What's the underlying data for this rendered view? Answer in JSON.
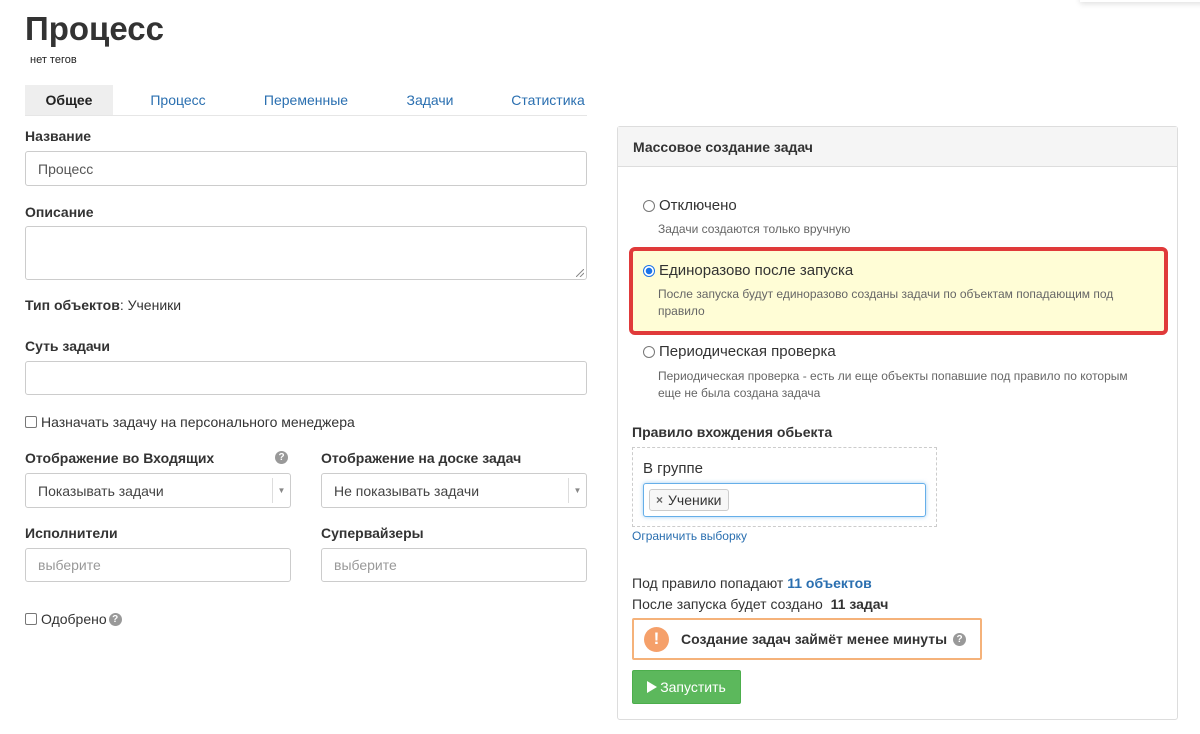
{
  "page": {
    "title": "Процесс",
    "tags": "нет тегов"
  },
  "tabs": [
    {
      "label": "Общее",
      "active": true
    },
    {
      "label": "Процесс",
      "active": false
    },
    {
      "label": "Переменные",
      "active": false
    },
    {
      "label": "Задачи",
      "active": false
    },
    {
      "label": "Статистика",
      "active": false
    }
  ],
  "form": {
    "name_label": "Название",
    "name_value": "Процесс",
    "description_label": "Описание",
    "description_value": "",
    "object_type_label": "Тип объектов",
    "object_type_value": ": Ученики",
    "task_essence_label": "Суть задачи",
    "task_essence_value": "",
    "assign_manager_label": "Назначать задачу на персонального менеджера",
    "assign_manager_checked": false,
    "inbox_display_label": "Отображение во Входящих",
    "inbox_display_value": "Показывать задачи",
    "board_display_label": "Отображение на доске задач",
    "board_display_value": "Не показывать задачи",
    "executors_label": "Исполнители",
    "executors_placeholder": "выберите",
    "supervisors_label": "Супервайзеры",
    "supervisors_placeholder": "выберите",
    "approved_label": "Одобрено",
    "approved_checked": false,
    "help_glyph": "?"
  },
  "mass_creation": {
    "header": "Массовое создание задач",
    "options": [
      {
        "title": "Отключено",
        "desc": "Задачи создаются только вручную",
        "checked": false
      },
      {
        "title": "Единоразово после запуска",
        "desc": "После запуска будут единоразово созданы задачи по объектам попадающим под правило",
        "checked": true
      },
      {
        "title": "Периодическая проверка",
        "desc": "Периодическая проверка - есть ли еще объекты попавшие под правило по которым еще не была создана задача",
        "checked": false
      }
    ],
    "rule_label": "Правило вхождения обьекта",
    "rule_group_label": "В группе",
    "rule_chip": "Ученики",
    "rule_chip_remove": "×",
    "limit_link": "Ограничить выборку",
    "matched_prefix": "Под правило попадают",
    "matched_value": "11 объектов",
    "created_prefix": "После запуска будет создано",
    "created_value": "11 задач",
    "warning_icon": "!",
    "warning_text": "Создание задач займёт менее минуты",
    "run_label": "Запустить",
    "run_icon": "play-icon"
  },
  "colors": {
    "accent_link": "#2a6fb0",
    "highlight_border": "#e03a3a",
    "highlight_bg": "#fffdd6",
    "run_button": "#5cb85c",
    "warning": "#f5a06a"
  }
}
